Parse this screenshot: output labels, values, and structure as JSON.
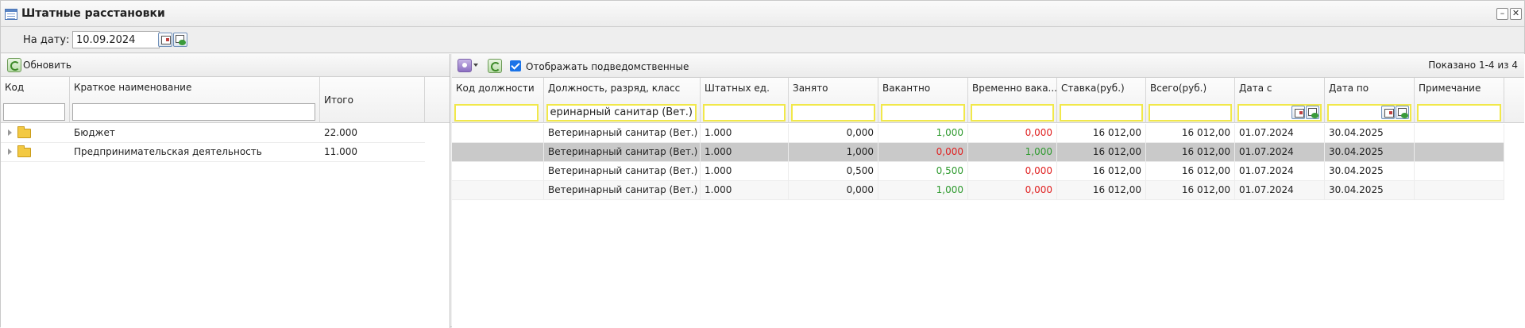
{
  "window": {
    "title": "Штатные расстановки",
    "minimize_glyph": "–",
    "close_glyph": "✕"
  },
  "datebar": {
    "label": "На дату:",
    "date_value": "10.09.2024"
  },
  "left": {
    "refresh_label": "Обновить",
    "columns": [
      "Код",
      "Краткое наименование",
      "Итого"
    ],
    "rows": [
      {
        "name": "Бюджет",
        "total": "22.000"
      },
      {
        "name": "Предпринимательская деятельность",
        "total": "11.000"
      }
    ]
  },
  "right": {
    "show_subordinate_label": "Отображать подведомственные",
    "shown_label": "Показано 1-4 из 4",
    "columns": [
      "Код должности",
      "Должность, разряд, класс",
      "Штатных ед.",
      "Занято",
      "Вакантно",
      "Временно вака...",
      "Ставка(руб.)",
      "Всего(руб.)",
      "Дата с",
      "Дата по",
      "Примечание"
    ],
    "position_filter_value": "Ветеринарный санитар (Вет.)",
    "rows": [
      {
        "code": "",
        "position": "Ветеринарный санитар (Вет.)",
        "units": "1.000",
        "occupied": "0,000",
        "vacant": "1,000",
        "temp_vacant": "0,000",
        "rate": "16 012,00",
        "total": "16 012,00",
        "date_from": "01.07.2024",
        "date_to": "30.04.2025",
        "note": ""
      },
      {
        "code": "",
        "position": "Ветеринарный санитар (Вет.)",
        "units": "1.000",
        "occupied": "1,000",
        "vacant": "0,000",
        "temp_vacant": "1,000",
        "rate": "16 012,00",
        "total": "16 012,00",
        "date_from": "01.07.2024",
        "date_to": "30.04.2025",
        "note": ""
      },
      {
        "code": "",
        "position": "Ветеринарный санитар (Вет.)",
        "units": "1.000",
        "occupied": "0,500",
        "vacant": "0,500",
        "temp_vacant": "0,000",
        "rate": "16 012,00",
        "total": "16 012,00",
        "date_from": "01.07.2024",
        "date_to": "30.04.2025",
        "note": ""
      },
      {
        "code": "",
        "position": "Ветеринарный санитар (Вет.)",
        "units": "1.000",
        "occupied": "0,000",
        "vacant": "1,000",
        "temp_vacant": "0,000",
        "rate": "16 012,00",
        "total": "16 012,00",
        "date_from": "01.07.2024",
        "date_to": "30.04.2025",
        "note": ""
      }
    ]
  },
  "colors": {
    "positive": "#2f9a2f",
    "negative": "#e02020",
    "selected_row": "#c9c9c9",
    "filter_highlight": "#f1e84a"
  },
  "icons": [
    "window-icon",
    "calendar-icon",
    "clear-date-icon",
    "refresh-icon",
    "settings-icon",
    "folder-icon",
    "expand-icon"
  ]
}
